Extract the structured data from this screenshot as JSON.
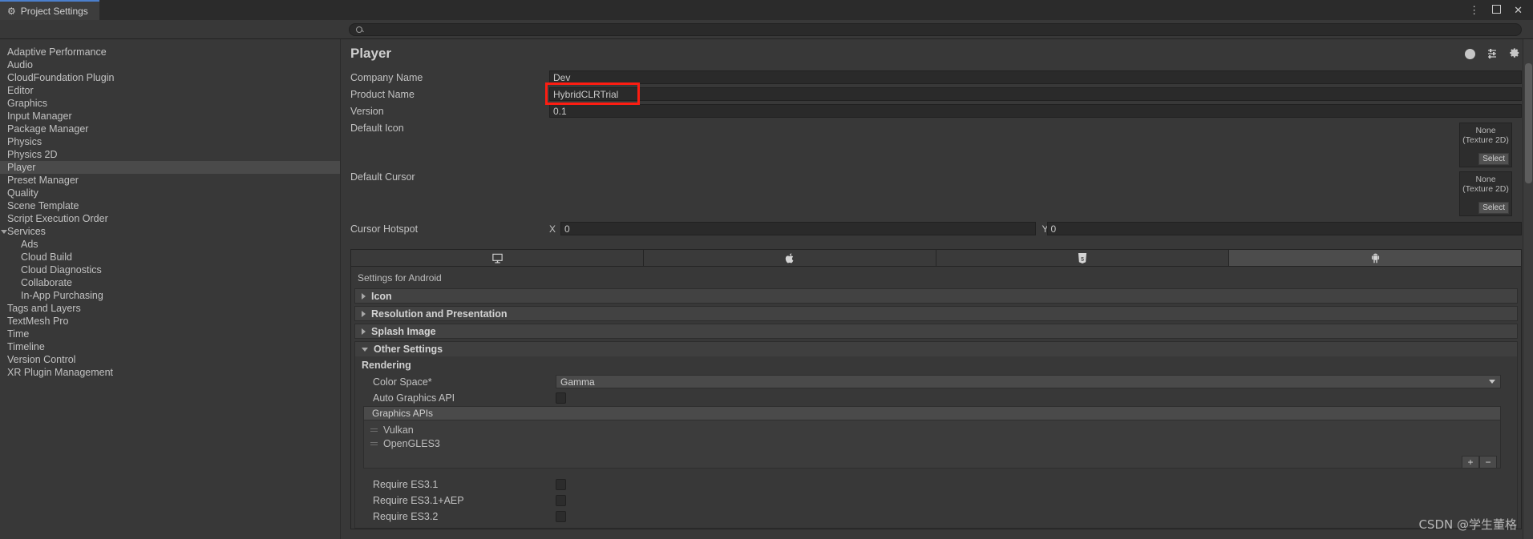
{
  "window": {
    "tab_title": "Project Settings",
    "tab_icon": "gear-icon",
    "controls": {
      "menu": "⋮",
      "maximize": "maximize-icon",
      "close": "✕"
    }
  },
  "search": {
    "placeholder": "",
    "value": "",
    "icon": "search-icon"
  },
  "sidebar": {
    "items": [
      {
        "label": "Adaptive Performance",
        "level": 0,
        "selected": false
      },
      {
        "label": "Audio",
        "level": 0,
        "selected": false
      },
      {
        "label": "CloudFoundation Plugin",
        "level": 0,
        "selected": false
      },
      {
        "label": "Editor",
        "level": 0,
        "selected": false
      },
      {
        "label": "Graphics",
        "level": 0,
        "selected": false
      },
      {
        "label": "Input Manager",
        "level": 0,
        "selected": false
      },
      {
        "label": "Package Manager",
        "level": 0,
        "selected": false
      },
      {
        "label": "Physics",
        "level": 0,
        "selected": false
      },
      {
        "label": "Physics 2D",
        "level": 0,
        "selected": false
      },
      {
        "label": "Player",
        "level": 0,
        "selected": true
      },
      {
        "label": "Preset Manager",
        "level": 0,
        "selected": false
      },
      {
        "label": "Quality",
        "level": 0,
        "selected": false
      },
      {
        "label": "Scene Template",
        "level": 0,
        "selected": false
      },
      {
        "label": "Script Execution Order",
        "level": 0,
        "selected": false
      },
      {
        "label": "Services",
        "level": 0,
        "selected": false,
        "expanded": true
      },
      {
        "label": "Ads",
        "level": 1,
        "selected": false
      },
      {
        "label": "Cloud Build",
        "level": 1,
        "selected": false
      },
      {
        "label": "Cloud Diagnostics",
        "level": 1,
        "selected": false
      },
      {
        "label": "Collaborate",
        "level": 1,
        "selected": false
      },
      {
        "label": "In-App Purchasing",
        "level": 1,
        "selected": false
      },
      {
        "label": "Tags and Layers",
        "level": 0,
        "selected": false
      },
      {
        "label": "TextMesh Pro",
        "level": 0,
        "selected": false
      },
      {
        "label": "Time",
        "level": 0,
        "selected": false
      },
      {
        "label": "Timeline",
        "level": 0,
        "selected": false
      },
      {
        "label": "Version Control",
        "level": 0,
        "selected": false
      },
      {
        "label": "XR Plugin Management",
        "level": 0,
        "selected": false
      }
    ]
  },
  "panel": {
    "title": "Player",
    "toolbar_icons": [
      "help-icon",
      "presets-icon",
      "settings-gear-icon"
    ],
    "fields": {
      "company_name": {
        "label": "Company Name",
        "value": "Dev"
      },
      "product_name": {
        "label": "Product Name",
        "value": "HybridCLRTrial",
        "highlighted": true,
        "highlight_color": "#fd1d12"
      },
      "version": {
        "label": "Version",
        "value": "0.1"
      },
      "default_icon": {
        "label": "Default Icon",
        "value": "None",
        "type_line": "(Texture 2D)",
        "select_label": "Select"
      },
      "default_cursor": {
        "label": "Default Cursor",
        "value": "None",
        "type_line": "(Texture 2D)",
        "select_label": "Select"
      },
      "cursor_hotspot": {
        "label": "Cursor Hotspot",
        "x_tag": "X",
        "x_value": "0",
        "y_tag": "Y",
        "y_value": "0"
      }
    },
    "platform_tabs": [
      {
        "name": "desktop",
        "icon": "monitor-icon",
        "active": false
      },
      {
        "name": "ios",
        "icon": "apple-icon",
        "active": false
      },
      {
        "name": "webgl",
        "icon": "html5-icon",
        "active": false
      },
      {
        "name": "android",
        "icon": "android-robot-icon",
        "active": true
      }
    ],
    "settings_for": "Settings for Android",
    "foldouts": [
      {
        "label": "Icon",
        "expanded": false
      },
      {
        "label": "Resolution and Presentation",
        "expanded": false
      },
      {
        "label": "Splash Image",
        "expanded": false
      },
      {
        "label": "Other Settings",
        "expanded": true
      }
    ],
    "other_settings": {
      "rendering_title": "Rendering",
      "color_space": {
        "label": "Color Space*",
        "value": "Gamma"
      },
      "auto_graphics_api": {
        "label": "Auto Graphics API",
        "checked": false
      },
      "graphics_apis": {
        "header": "Graphics APIs",
        "items": [
          "Vulkan",
          "OpenGLES3"
        ],
        "add_label": "+",
        "remove_label": "−"
      },
      "requirements": [
        {
          "label": "Require ES3.1",
          "checked": false
        },
        {
          "label": "Require ES3.1+AEP",
          "checked": false
        },
        {
          "label": "Require ES3.2",
          "checked": false
        }
      ]
    }
  },
  "watermark": {
    "text": "CSDN @学生董格"
  }
}
